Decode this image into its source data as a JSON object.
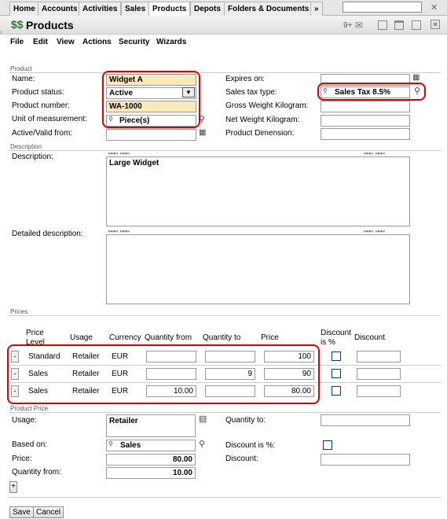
{
  "tabs": [
    "Home",
    "Accounts",
    "Activities",
    "Sales",
    "Products",
    "Depots",
    "Folders & Documents",
    "»"
  ],
  "page_title": "Products",
  "title_bar": {
    "badge": "9+"
  },
  "menu": [
    "File",
    "Edit",
    "View",
    "Actions",
    "Security",
    "Wizards"
  ],
  "sections": {
    "product": "Product",
    "description": "Description",
    "prices": "Prices",
    "product_price": "Product Price"
  },
  "product": {
    "name_label": "Name:",
    "name_value": "Widget A",
    "status_label": "Product status:",
    "status_value": "Active",
    "number_label": "Product number:",
    "number_value": "WA-1000",
    "unit_label": "Unit of measurement:",
    "unit_value": "Piece(s)",
    "valid_from_label": "Active/Valid from:",
    "expires_label": "Expires on:",
    "tax_label": "Sales tax type:",
    "tax_value": "Sales Tax 8.5%",
    "gross_label": "Gross Weight Kilogram:",
    "net_label": "Net Weight Kilogram:",
    "dimension_label": "Product Dimension:"
  },
  "description": {
    "desc_label": "Description:",
    "desc_value": "Large Widget",
    "detailed_label": "Detailed description:"
  },
  "prices": {
    "headers": [
      "Price Level",
      "Usage",
      "Currency",
      "Quantity from",
      "Quantity to",
      "Price",
      "Discount is %",
      "Discount"
    ],
    "rows": [
      {
        "level": "Standard",
        "usage": "Retailer",
        "currency": "EUR",
        "qty_from": "",
        "qty_to": "",
        "price": "100",
        "discount": ""
      },
      {
        "level": "Sales",
        "usage": "Retailer",
        "currency": "EUR",
        "qty_from": "",
        "qty_to": "9",
        "price": "90",
        "discount": ""
      },
      {
        "level": "Sales",
        "usage": "Retailer",
        "currency": "EUR",
        "qty_from": "10.00",
        "qty_to": "",
        "price": "80.00",
        "discount": ""
      }
    ]
  },
  "product_price": {
    "usage_label": "Usage:",
    "usage_value": "Retailer",
    "based_label": "Based on:",
    "based_value": "Sales",
    "price_label": "Price:",
    "price_value": "80.00",
    "qty_from_label": "Quantity from:",
    "qty_from_value": "10.00",
    "qty_to_label": "Quantity to:",
    "discount_pct_label": "Discount is %:",
    "discount_label": "Discount:"
  },
  "buttons": {
    "save": "Save",
    "cancel": "Cancel",
    "add": "+",
    "remove": "-"
  },
  "colors": {
    "highlight_border": "#e00000",
    "required_field": "#fde9b8"
  }
}
